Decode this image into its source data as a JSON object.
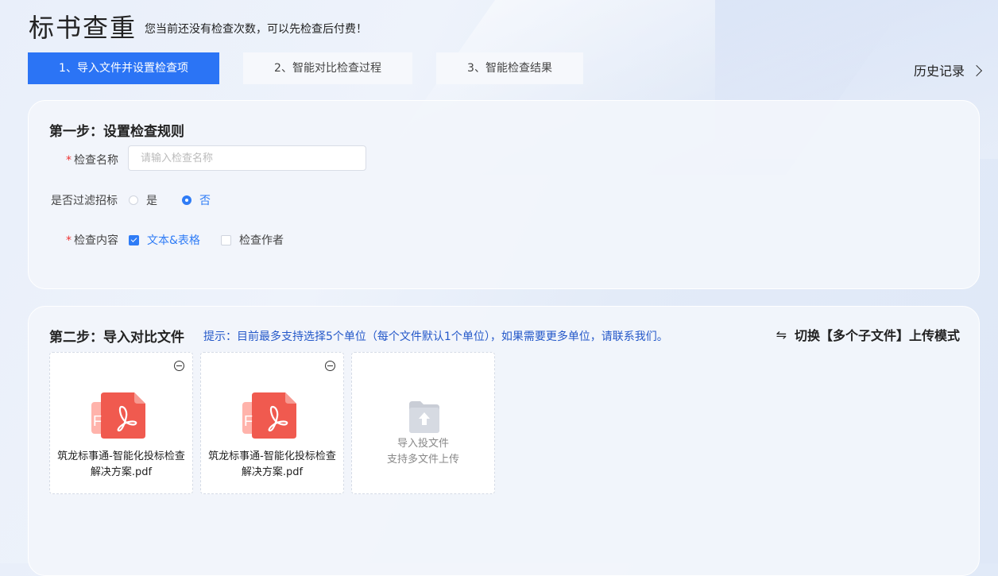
{
  "header": {
    "title": "标书查重",
    "subtitle": "您当前还没有检查次数，可以先检查后付费！"
  },
  "tabs": [
    {
      "label": "1、导入文件并设置检查项",
      "active": true
    },
    {
      "label": "2、智能对比检查过程",
      "active": false
    },
    {
      "label": "3、智能检查结果",
      "active": false
    }
  ],
  "history": {
    "label": "历史记录",
    "icon": "chevron-right-icon"
  },
  "step1": {
    "title": "第一步：设置检查规则",
    "name_field": {
      "required_mark": "*",
      "label": "检查名称",
      "placeholder": "请输入检查名称",
      "value": ""
    },
    "filter": {
      "label": "是否过滤招标",
      "options": [
        "是",
        "否"
      ],
      "selected": "否"
    },
    "content": {
      "required_mark": "*",
      "label": "检查内容",
      "options": [
        {
          "label": "文本&表格",
          "checked": true
        },
        {
          "label": "检查作者",
          "checked": false
        }
      ]
    }
  },
  "step2": {
    "title": "第二步：导入对比文件",
    "hint": "提示：目前最多支持选择5个单位（每个文件默认1个单位），如果需要更多单位，请联系我们。",
    "switch_label": "切换【多个子文件】上传模式",
    "switch_icon": "swap-icon",
    "files": [
      {
        "name": "筑龙标事通-智能化投标检查解决方案.pdf",
        "icon": "pdf-file-icon"
      },
      {
        "name": "筑龙标事通-智能化投标检查解决方案.pdf",
        "icon": "pdf-file-icon"
      }
    ],
    "upload": {
      "line1": "导入投文件",
      "line2": "支持多文件上传",
      "icon": "folder-upload-icon"
    }
  },
  "colors": {
    "accent": "#2b74f5",
    "hint": "#2458c9",
    "required": "#e33333",
    "pdf_red": "#f05a4f"
  }
}
